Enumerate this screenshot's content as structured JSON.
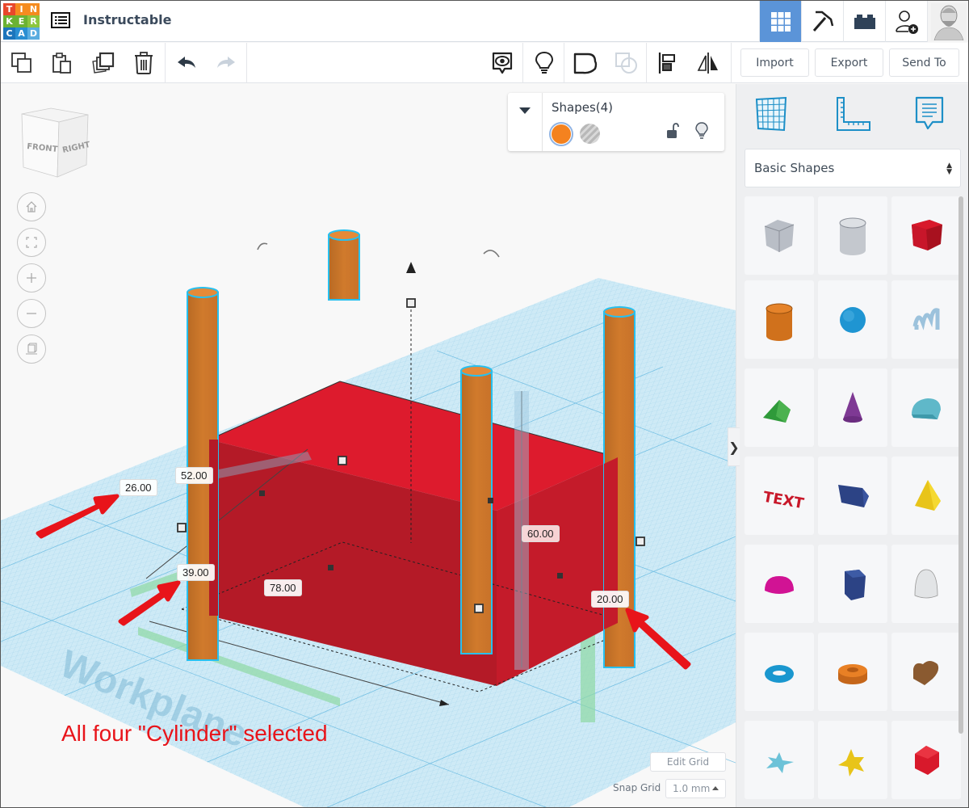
{
  "app": {
    "logo_letters": [
      "T",
      "I",
      "N",
      "K",
      "E",
      "R",
      "C",
      "A",
      "D"
    ],
    "logo_colors": [
      "#e8472b",
      "#f58b1f",
      "#f58b1f",
      "#6bb232",
      "#6bb232",
      "#8cc63e",
      "#1c75bc",
      "#2a8fd2",
      "#5aade0"
    ],
    "project_title": "Instructable"
  },
  "topnav": {
    "items": [
      {
        "name": "3d-design-view",
        "icon": "grid-icon",
        "active": true
      },
      {
        "name": "codeblocks-view",
        "icon": "pickaxe-icon",
        "active": false
      },
      {
        "name": "bricks-view",
        "icon": "brick-icon",
        "active": false
      },
      {
        "name": "invite-user",
        "icon": "add-user-icon",
        "active": false
      },
      {
        "name": "profile",
        "icon": "avatar",
        "active": false
      }
    ],
    "accent": "#5b94d8"
  },
  "toolbar": {
    "left": [
      "copy",
      "paste",
      "duplicate",
      "delete",
      "undo",
      "redo"
    ],
    "right": [
      "show-all",
      "light",
      "group",
      "ungroup",
      "align",
      "mirror"
    ],
    "import_label": "Import",
    "export_label": "Export",
    "sendto_label": "Send To"
  },
  "viewcube": {
    "front": "FRONT",
    "right": "RIGHT"
  },
  "view_controls": [
    "home",
    "fit",
    "zoom-in",
    "zoom-out",
    "ortho-perspective"
  ],
  "shapes_panel": {
    "title": "Shapes(4)",
    "solid_color": "#f4821f",
    "hole_selected": false,
    "locked": false
  },
  "dimensions": {
    "d1": "26.00",
    "d2": "52.00",
    "d3": "39.00",
    "d4": "78.00",
    "height": "60.00",
    "elevation": "20.00"
  },
  "workplane_label": "Workplane",
  "annotation": "All four \"Cylinder\" selected",
  "grid_controls": {
    "edit_grid_label": "Edit Grid",
    "snap_grid_label": "Snap Grid",
    "snap_grid_value": "1.0 mm"
  },
  "right_panel": {
    "tabs": [
      "workplane",
      "ruler",
      "notes"
    ],
    "library": "Basic Shapes",
    "shapes": [
      "Box Hole",
      "Cylinder Hole",
      "Box",
      "Cylinder",
      "Sphere",
      "Scribble",
      "Roof",
      "Cone",
      "Round Roof",
      "Text",
      "Wedge",
      "Pyramid",
      "Half Sphere",
      "Polygon",
      "Paraboloid",
      "Torus",
      "Tube",
      "Heart",
      "Star",
      "Star Six Point",
      "Icosahedron"
    ]
  }
}
